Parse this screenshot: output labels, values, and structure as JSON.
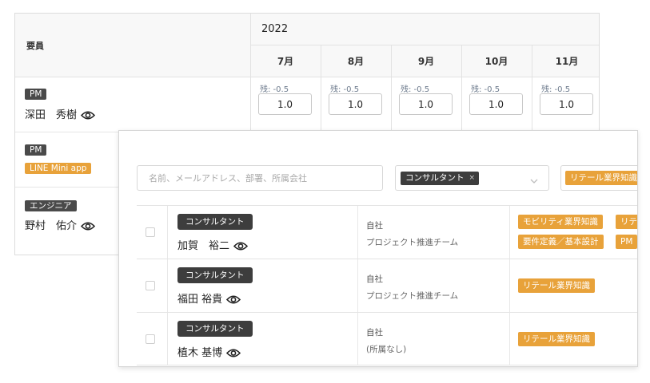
{
  "schedule": {
    "member_header": "要員",
    "year": "2022",
    "months": [
      "7月",
      "8月",
      "9月",
      "10月",
      "11月"
    ],
    "rows": [
      {
        "role": "PM",
        "name": "深田　秀樹",
        "remaining": [
          "残: -0.5",
          "残: -0.5",
          "残: -0.5",
          "残: -0.5",
          "残: -0.5"
        ],
        "allocations": [
          "1.0",
          "1.0",
          "1.0",
          "1.0",
          "1.0"
        ]
      },
      {
        "role": "PM",
        "team": "LINE Mini app"
      },
      {
        "role": "エンジニア",
        "name": "野村　佑介"
      }
    ]
  },
  "search": {
    "placeholder": "名前、メールアドレス、部署、所属会社",
    "role_filter_tag": "コンサルタント",
    "role_filter_remove": "×",
    "skill_filter_tag": "リテール業界知識"
  },
  "results": [
    {
      "role": "コンサルタント",
      "name": "加賀　裕二",
      "company": "自社",
      "department": "プロジェクト推進チーム",
      "skills": [
        "モビリティ業界知識",
        "リテ",
        "要件定義／基本設計",
        "PM"
      ]
    },
    {
      "role": "コンサルタント",
      "name": "福田 裕貴",
      "company": "自社",
      "department": "プロジェクト推進チーム",
      "skills": [
        "リテール業界知識"
      ]
    },
    {
      "role": "コンサルタント",
      "name": "植木 基博",
      "company": "自社",
      "department": "(所属なし)",
      "skills": [
        "リテール業界知識"
      ]
    }
  ],
  "colors": {
    "accent": "#e8a23a",
    "badge_dark": "#3d3d3d"
  },
  "icons": {
    "eye": "eye-icon",
    "chevron": "chevron-down-icon"
  }
}
